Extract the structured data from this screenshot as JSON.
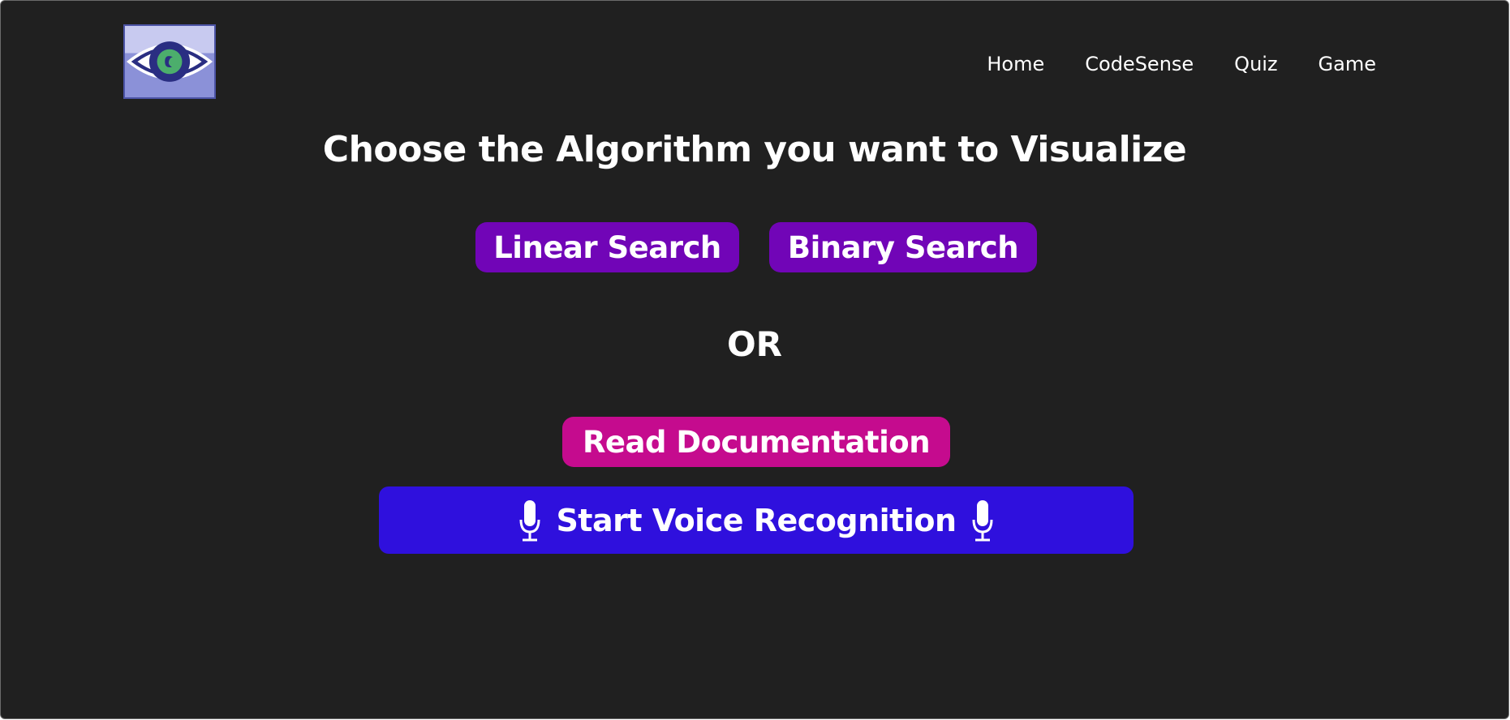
{
  "logo": {
    "icon": "eye-logo-icon"
  },
  "nav": {
    "items": [
      {
        "label": "Home"
      },
      {
        "label": "CodeSense"
      },
      {
        "label": "Quiz"
      },
      {
        "label": "Game"
      }
    ]
  },
  "main": {
    "title": "Choose the Algorithm you want to Visualize",
    "algorithms": [
      {
        "label": "Linear Search"
      },
      {
        "label": "Binary Search"
      }
    ],
    "separator": "OR",
    "documentation_label": "Read Documentation",
    "voice_label": "Start Voice Recognition",
    "voice_icon": "microphone-icon"
  },
  "colors": {
    "background": "#202020",
    "algorithm_button": "#7105b7",
    "documentation_button": "#c50b8e",
    "voice_button": "#2f10dd",
    "text": "#ffffff"
  }
}
